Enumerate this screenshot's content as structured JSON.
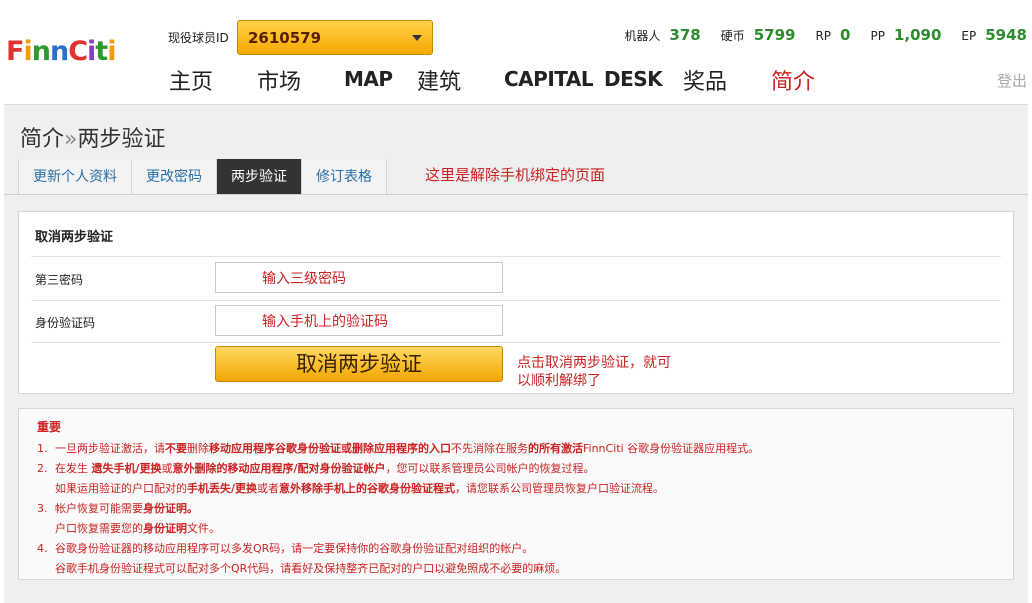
{
  "header": {
    "logo_text": "FinnCiti",
    "id_label": "现役球员ID",
    "player_id": "2610579",
    "stats": [
      {
        "label": "机器人",
        "value": "378"
      },
      {
        "label": "硬币",
        "value": "5799"
      },
      {
        "label": "RP",
        "value": "0"
      },
      {
        "label": "PP",
        "value": "1,090"
      },
      {
        "label": "EP",
        "value": "5948"
      }
    ],
    "nav": [
      {
        "label": "主页"
      },
      {
        "label": "市场"
      },
      {
        "label": "MAP"
      },
      {
        "label": "建筑"
      },
      {
        "label": "CAPITAL"
      },
      {
        "label": "DESK"
      },
      {
        "label": "奖品"
      },
      {
        "label": "简介"
      }
    ],
    "logout": "登出"
  },
  "page": {
    "breadcrumb_root": "简介",
    "breadcrumb_sep": "»",
    "breadcrumb_current": "两步验证",
    "tabs": [
      {
        "label": "更新个人资料"
      },
      {
        "label": "更改密码"
      },
      {
        "label": "两步验证"
      },
      {
        "label": "修订表格"
      }
    ],
    "tab_note": "这里是解除手机绑定的页面"
  },
  "form": {
    "title": "取消两步验证",
    "password_label": "第三密码",
    "password_hint": "输入三级密码",
    "code_label": "身份验证码",
    "code_hint": "输入手机上的验证码",
    "submit_label": "取消两步验证",
    "submit_note_line1": "点击取消两步验证，就可",
    "submit_note_line2": "以顺利解绑了"
  },
  "important": {
    "title": "重要",
    "items": [
      {
        "num": "1.",
        "pre": "一旦两步验证激活，请",
        "b1": "不要",
        "mid1": "删除",
        "b2": "移动应用程序谷歌身份验证或删除应用程序的入口",
        "mid2": "不先消除在服务",
        "b3": "的所有激活",
        "post": "FinnCiti 谷歌身份验证器应用程式。"
      },
      {
        "num": "2.",
        "pre": "在发生 ",
        "b1": "遗失手机/更换",
        "mid1": "或",
        "b2": "意外删除的移动应用程序/配对身份验证帐户",
        "mid2": "，您可以联系管理员公司帐户的恢复过程。",
        "b3": "",
        "post": ""
      },
      {
        "num": "",
        "pre": "如果运用验证的户口配对的",
        "b1": "手机丢失/更换",
        "mid1": "或者",
        "b2": "意外移除手机上的谷歌身份验证程式",
        "mid2": "，请您联系公司管理员恢复户口验证流程。",
        "b3": "",
        "post": ""
      },
      {
        "num": "3.",
        "pre": "帐户恢复可能需要",
        "b1": "身份证明。",
        "mid1": "",
        "b2": "",
        "mid2": "",
        "b3": "",
        "post": ""
      },
      {
        "num": "",
        "pre": "户口恢复需要您的",
        "b1": "身份证明",
        "mid1": "文件。",
        "b2": "",
        "mid2": "",
        "b3": "",
        "post": ""
      },
      {
        "num": "4.",
        "pre": "谷歌身份验证器的移动应用程序可以多发QR码，请一定要保持你的谷歌身份验证配对组织的帐户。",
        "b1": "",
        "mid1": "",
        "b2": "",
        "mid2": "",
        "b3": "",
        "post": ""
      },
      {
        "num": "",
        "pre": "谷歌手机身份验证程式可以配对多个QR代码，请看好及保持整齐已配对的户口以避免照成不必要的麻烦。",
        "b1": "",
        "mid1": "",
        "b2": "",
        "mid2": "",
        "b3": "",
        "post": ""
      }
    ]
  },
  "colors": {
    "accent_red": "#cc2222",
    "stat_green": "#2e8b2e",
    "button_gold": "#f5a800"
  }
}
